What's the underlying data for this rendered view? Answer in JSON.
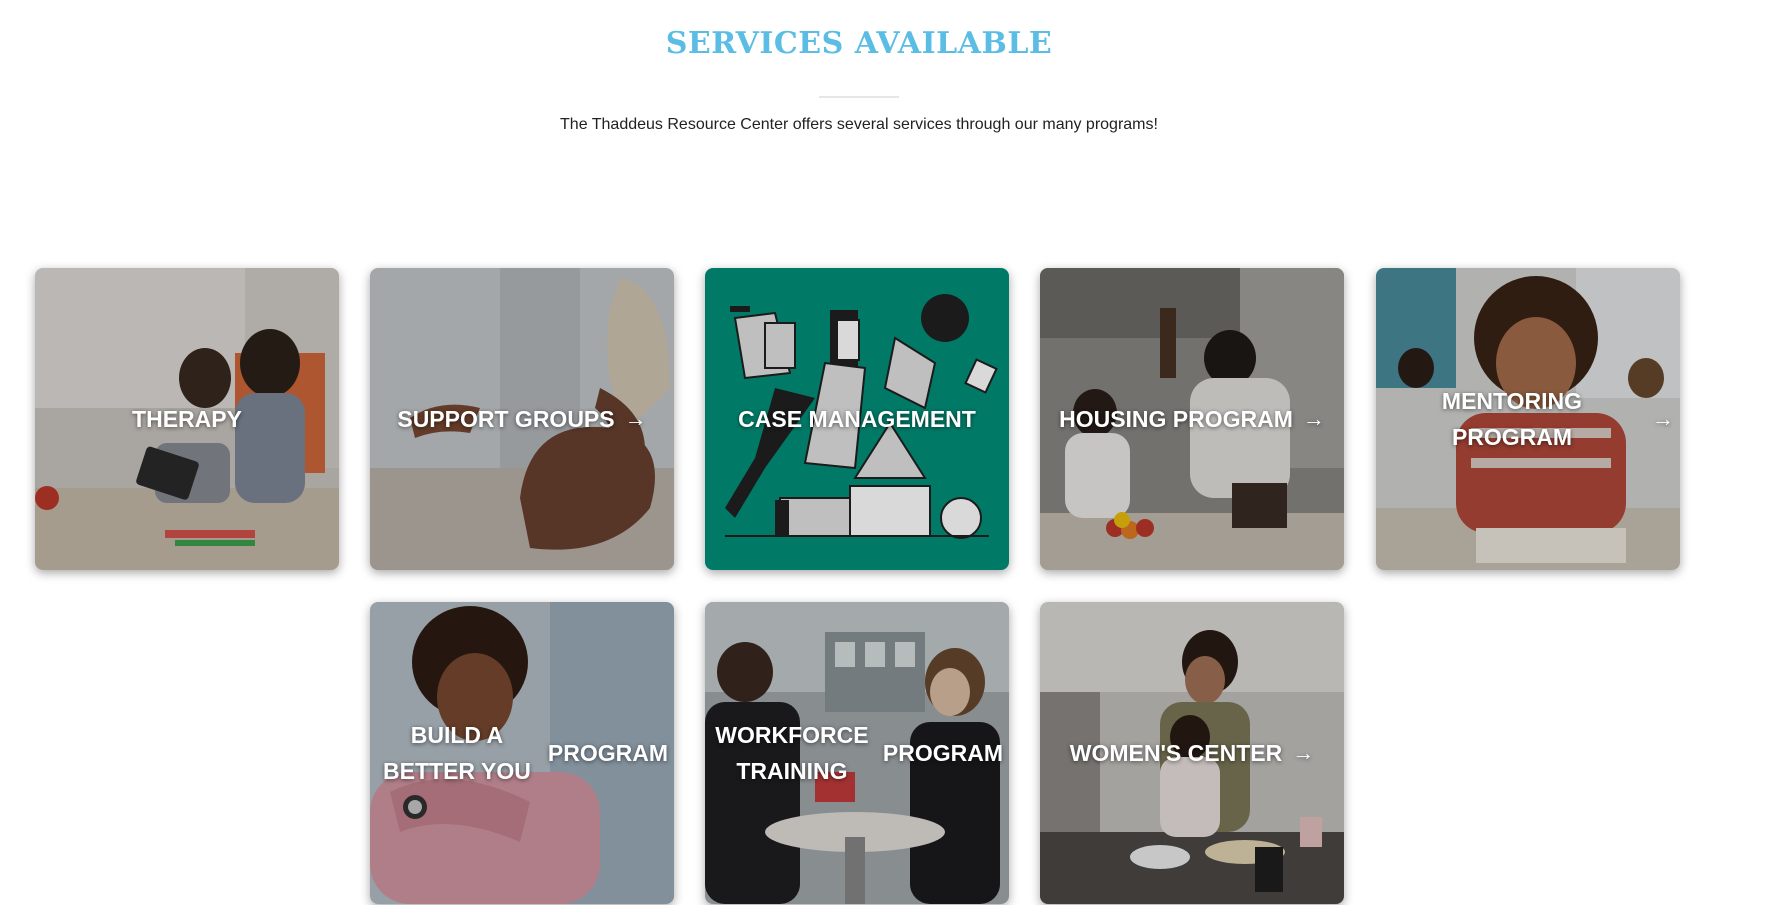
{
  "section": {
    "title": "SERVICES AVAILABLE",
    "intro": "The Thaddeus Resource Center offers several services through our many programs!"
  },
  "colors": {
    "title": "#5bbde4",
    "case_management_bg": "#007a67"
  },
  "arrow_icon": "arrow-right-icon",
  "arrow_glyph": "→",
  "cards": [
    {
      "label": "THERAPY"
    },
    {
      "label": "SUPPORT GROUPS"
    },
    {
      "label": "CASE MANAGEMENT"
    },
    {
      "label": "HOUSING PROGRAM"
    },
    {
      "label": "MENTORING PROGRAM"
    },
    {
      "label_line1": "BUILD A BETTER YOU",
      "label_line2": "PROGRAM"
    },
    {
      "label_line1": "WORKFORCE TRAINING",
      "label_line2": "PROGRAM"
    },
    {
      "label": "WOMEN'S CENTER"
    }
  ]
}
